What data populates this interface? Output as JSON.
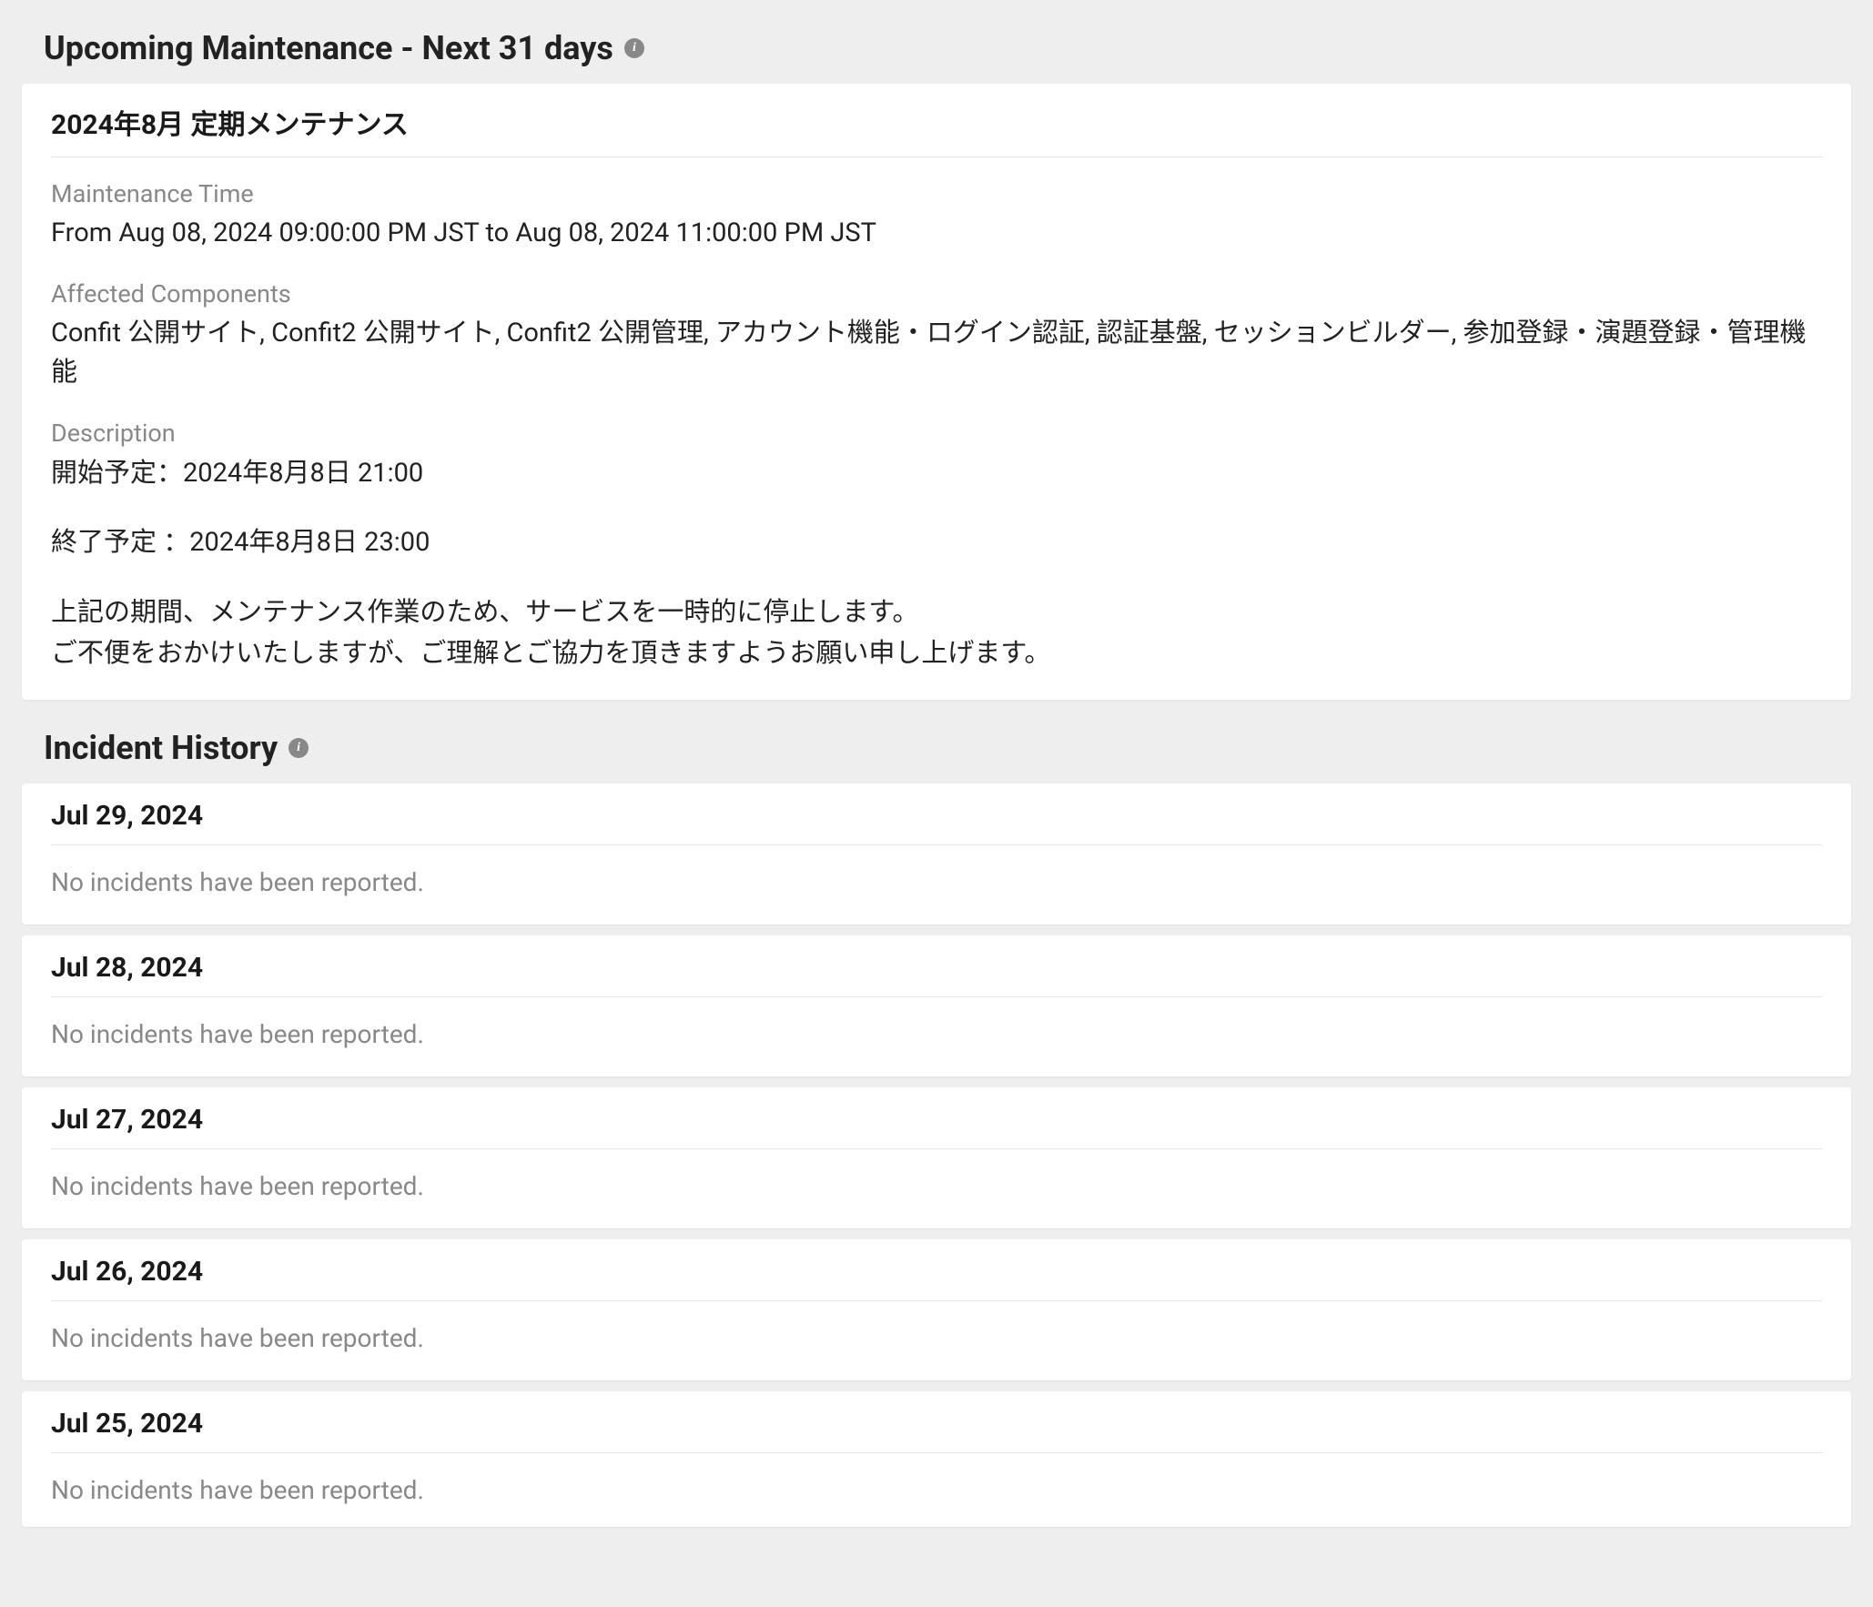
{
  "upcoming": {
    "heading": "Upcoming Maintenance - Next 31 days",
    "card": {
      "title": "2024年8月 定期メンテナンス",
      "maintenance_time_label": "Maintenance Time",
      "maintenance_time_value": "From Aug 08, 2024 09:00:00 PM JST to Aug 08, 2024 11:00:00 PM JST",
      "affected_label": "Affected Components",
      "affected_value": "Confit 公開サイト, Confit2 公開サイト, Confit2 公開管理, アカウント機能・ログイン認証, 認証基盤, セッションビルダー, 参加登録・演題登録・管理機能",
      "description_label": "Description",
      "desc_start": "開始予定：2024年8月8日 21:00",
      "desc_end": "終了予定 ：2024年8月8日 23:00",
      "desc_line1": "上記の期間、メンテナンス作業のため、サービスを一時的に停止します。",
      "desc_line2": "ご不便をおかけいたしますが、ご理解とご協力を頂きますようお願い申し上げます。"
    }
  },
  "history": {
    "heading": "Incident History",
    "no_incidents": "No incidents have been reported.",
    "days": [
      {
        "date": "Jul 29, 2024"
      },
      {
        "date": "Jul 28, 2024"
      },
      {
        "date": "Jul 27, 2024"
      },
      {
        "date": "Jul 26, 2024"
      },
      {
        "date": "Jul 25, 2024"
      }
    ]
  }
}
